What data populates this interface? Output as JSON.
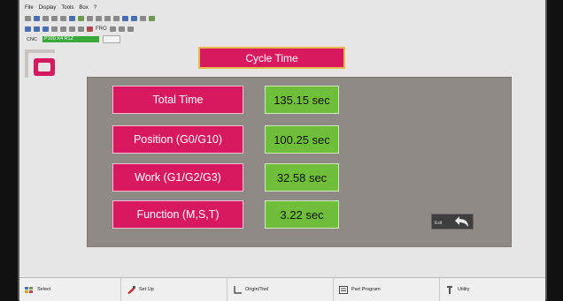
{
  "menu": [
    "File",
    "Display",
    "Tools",
    "Box",
    "?"
  ],
  "toolbar": {
    "run_field": "FRO"
  },
  "cnc": {
    "label": "CNC",
    "field": "P100 X4 R1Z"
  },
  "title": "Cycle Time",
  "rows": [
    {
      "label": "Total Time",
      "value": "135.15 sec"
    },
    {
      "label": "Position (G0/G10)",
      "value": "100.25 sec"
    },
    {
      "label": "Work (G1/G2/G3)",
      "value": "32.58 sec"
    },
    {
      "label": "Function (M,S,T)",
      "value": "3.22 sec"
    }
  ],
  "exit_label": "Exit",
  "bottom": [
    {
      "label": "Select",
      "icon": "select-icon"
    },
    {
      "label": "Set Up",
      "icon": "setup-icon"
    },
    {
      "label": "Origin/Tool",
      "icon": "origin-tool-icon"
    },
    {
      "label": "Part Program",
      "icon": "part-program-icon"
    },
    {
      "label": "Utility",
      "icon": "utility-icon"
    }
  ],
  "colors": {
    "accent": "#d8195f",
    "value": "#6fbf3a",
    "panel": "#8f8a86",
    "titleBorder": "#e9b84a"
  }
}
